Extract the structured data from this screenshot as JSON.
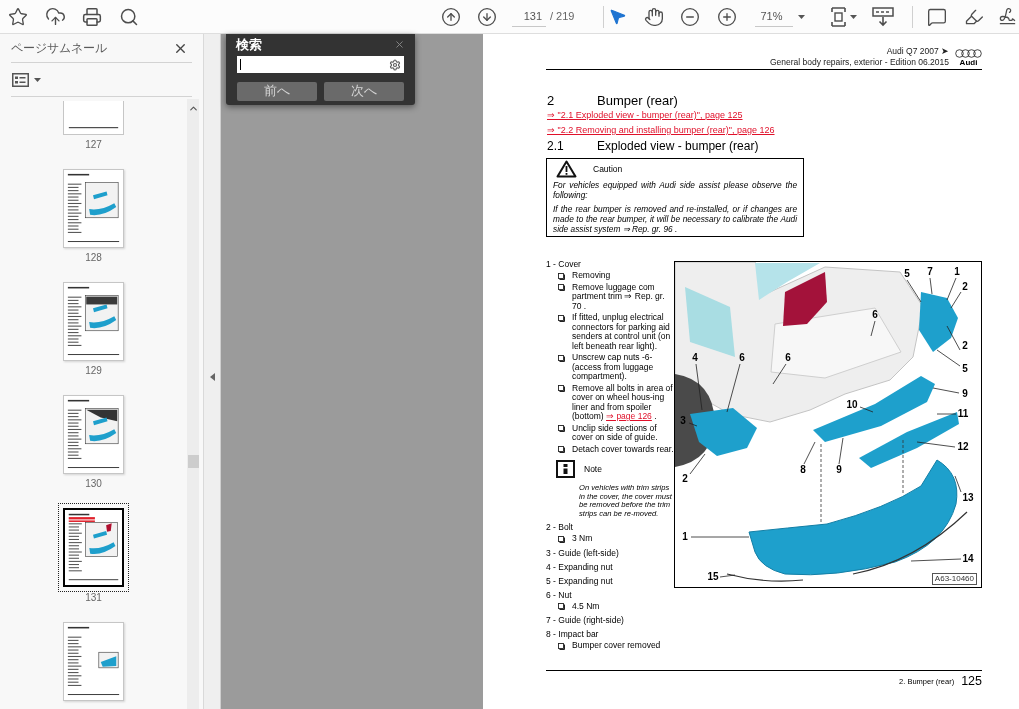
{
  "toolbar": {
    "page_number": "131",
    "page_total": "/ 219",
    "tools": [
      {
        "selected": true
      },
      {
        "selected": false
      }
    ],
    "zoom": "71%"
  },
  "sidebar": {
    "title": "ページサムネール",
    "thumbnails": [
      {
        "kind": "partial",
        "label": "127",
        "selected": false
      },
      {
        "kind": "page",
        "label": "128",
        "selected": false
      },
      {
        "kind": "page",
        "label": "129",
        "selected": false
      },
      {
        "kind": "page",
        "label": "130",
        "selected": false
      },
      {
        "kind": "page",
        "label": "131",
        "selected": true
      },
      {
        "kind": "page",
        "selected": false
      }
    ]
  },
  "search_panel": {
    "title": "検索",
    "buttons": [
      "前へ",
      "次へ"
    ]
  },
  "document": {
    "header": {
      "model": "Audi Q7 2007 ➤",
      "subtitle": "General body repairs, exterior - Edition 06.2015",
      "logo_text": "Audi"
    },
    "section": {
      "number": "2",
      "title": "Bumper (rear)"
    },
    "links": [
      "⇒ \"2.1 Exploded view - bumper (rear)\", page 125",
      "⇒ \"2.2 Removing and installing bumper (rear)\", page 126"
    ],
    "subsection": {
      "number": "2.1",
      "title": "Exploded view - bumper (rear)"
    },
    "caution": {
      "title": "Caution",
      "paragraphs": [
        "For vehicles equipped with Audi side assist please observe the following:",
        "If the rear bumper is removed and re-installed, or if changes are made to the rear bumper, it will be necessary to calibrate the Audi side assist system ⇒ Rep. gr. 96 ."
      ]
    },
    "parts": [
      {
        "label": "1 - Cover",
        "steps": [
          {
            "text": "Removing"
          },
          {
            "text": "Remove luggage com partment trim ⇒ Rep. gr. 70 ."
          },
          {
            "text": "If fitted, unplug electrical connectors for parking aid senders at control unit (on left beneath rear light)."
          },
          {
            "text": "Unscrew cap nuts -6- (access from luggage compartment)."
          },
          {
            "text": "Remove all bolts in area of cover on wheel hous-ing liner and from spoiler (bottom)",
            "link": "⇒ page 126",
            "after": "."
          },
          {
            "text": "Unclip side sections of cover on side of guide."
          },
          {
            "text": "Detach cover towards rear."
          }
        ],
        "note": {
          "title": "Note",
          "text": "On vehicles with trim strips in the cover, the cover must be removed before the trim strips can be re-moved."
        }
      },
      {
        "label": "2 - Bolt",
        "steps": [
          {
            "text": "3 Nm"
          }
        ]
      },
      {
        "label": "3 - Guide (left-side)"
      },
      {
        "label": "4 - Expanding nut"
      },
      {
        "label": "5 - Expanding nut"
      },
      {
        "label": "6 - Nut",
        "steps": [
          {
            "text": "4.5 Nm"
          }
        ]
      },
      {
        "label": "7 - Guide (right-side)"
      },
      {
        "label": "8 - Impact bar",
        "steps": [
          {
            "text": "Bumper cover removed"
          }
        ]
      }
    ],
    "figure": {
      "callouts": [
        "5",
        "7",
        "1",
        "2",
        "6",
        "2",
        "5",
        "4",
        "6",
        "6",
        "9",
        "10",
        "11",
        "3",
        "12",
        "8",
        "9",
        "2",
        "13",
        "1",
        "14",
        "15"
      ],
      "image_id": "A63-10460"
    },
    "footer": {
      "section": "2. Bumper (rear)",
      "page": "125"
    }
  }
}
